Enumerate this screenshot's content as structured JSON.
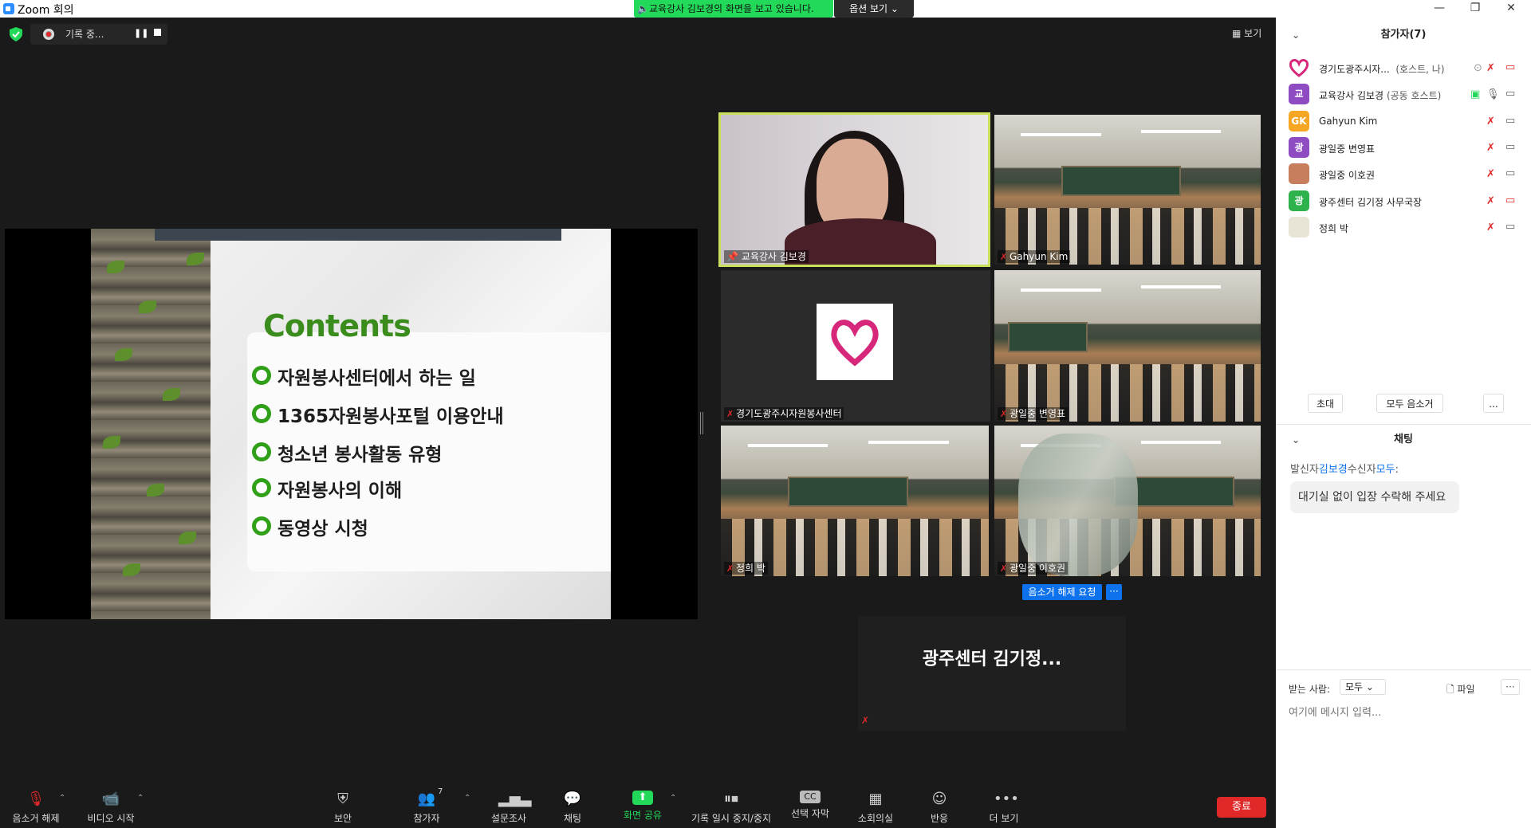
{
  "window": {
    "title": "Zoom 회의"
  },
  "share_banner": {
    "text": "교육강사 김보경의 화면을 보고 있습니다.",
    "view_options": "옵션 보기"
  },
  "recording": {
    "label": "기록 중..."
  },
  "view_button": "보기",
  "slide": {
    "title": "Contents",
    "items": [
      "자원봉사센터에서 하는 일",
      "1365자원봉사포털 이용안내",
      "청소년 봉사활동 유형",
      "자원봉사의 이해",
      "동영상 시청"
    ]
  },
  "tiles": [
    {
      "name": "교육강사 김보경"
    },
    {
      "name": "Gahyun Kim"
    },
    {
      "name": "경기도광주시자원봉사센터"
    },
    {
      "name": "광일중 변영표"
    },
    {
      "name": "정희 박"
    },
    {
      "name": "광일중 이호권"
    }
  ],
  "unmute_request": "음소거 해제 요청",
  "more_label": "···",
  "big_name_tile": "광주센터 김기정...",
  "toolbar": {
    "unmute": "음소거 해제",
    "start_video": "비디오 시작",
    "security": "보안",
    "participants": "참가자",
    "participants_count": "7",
    "polls": "설문조사",
    "chat": "채팅",
    "share_screen": "화면 공유",
    "pause_recording": "기록 일시 중지/중지",
    "captions": "선택 자막",
    "breakout": "소회의실",
    "reactions": "반응",
    "more": "더 보기",
    "end": "종료"
  },
  "participants_panel": {
    "header": "참가자(7)",
    "rows": [
      {
        "name": "경기도광주시자...",
        "role": "(호스트, 나)",
        "avatar": "",
        "color": "#ffffff"
      },
      {
        "name": "교육강사 김보경",
        "role": "(공동 호스트)",
        "avatar": "교",
        "color": "#8f4bc1"
      },
      {
        "name": "Gahyun Kim",
        "role": "",
        "avatar": "GK",
        "color": "#f5a623"
      },
      {
        "name": "광일중 변영표",
        "role": "",
        "avatar": "광",
        "color": "#8f4bc1"
      },
      {
        "name": "광일중 이호권",
        "role": "",
        "avatar": "",
        "color": "#c77e5c"
      },
      {
        "name": "광주센터 김기정 사무국장",
        "role": "",
        "avatar": "광",
        "color": "#2eb24b"
      },
      {
        "name": "정희 박",
        "role": "",
        "avatar": "",
        "color": "#e8e4d6"
      }
    ],
    "invite": "초대",
    "mute_all": "모두 음소거",
    "more": "..."
  },
  "chat_panel": {
    "header": "채팅",
    "sender_prefix": "발신자",
    "sender": "김보경",
    "receiver_prefix": "수신자",
    "receiver": "모두",
    "colon": ":",
    "message": "대기실 없이 입장 수락해 주세요",
    "to_label": "받는 사람:",
    "to_value": "모두",
    "file": "파일",
    "placeholder": "여기에 메시지 입력..."
  }
}
